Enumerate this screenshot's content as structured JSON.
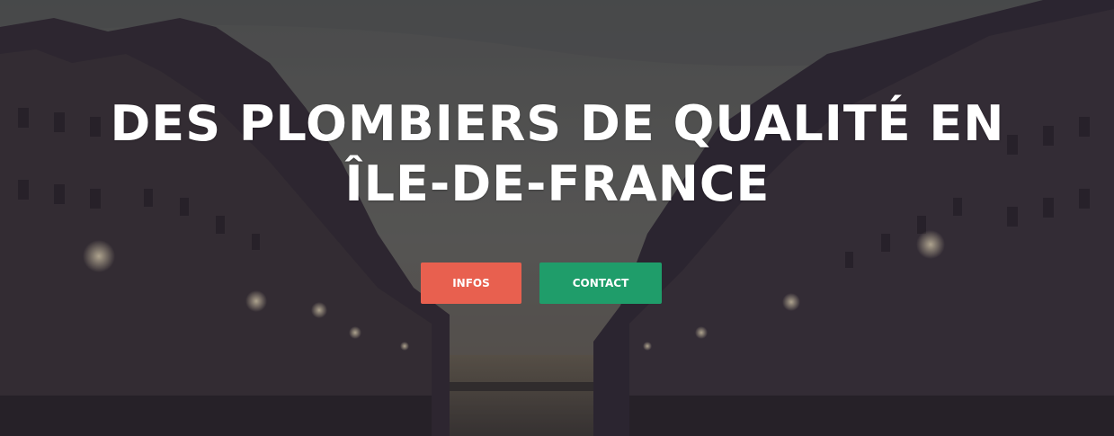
{
  "hero": {
    "title": "DES PLOMBIERS DE QUALITÉ EN ÎLE-DE-FRANCE",
    "buttons": {
      "infos_label": "INFOS",
      "contact_label": "CONTACT"
    },
    "colors": {
      "infos_button": "#e8604f",
      "contact_button": "#1f9d6a",
      "overlay": "#3e3b40",
      "title_text": "#ffffff"
    }
  }
}
